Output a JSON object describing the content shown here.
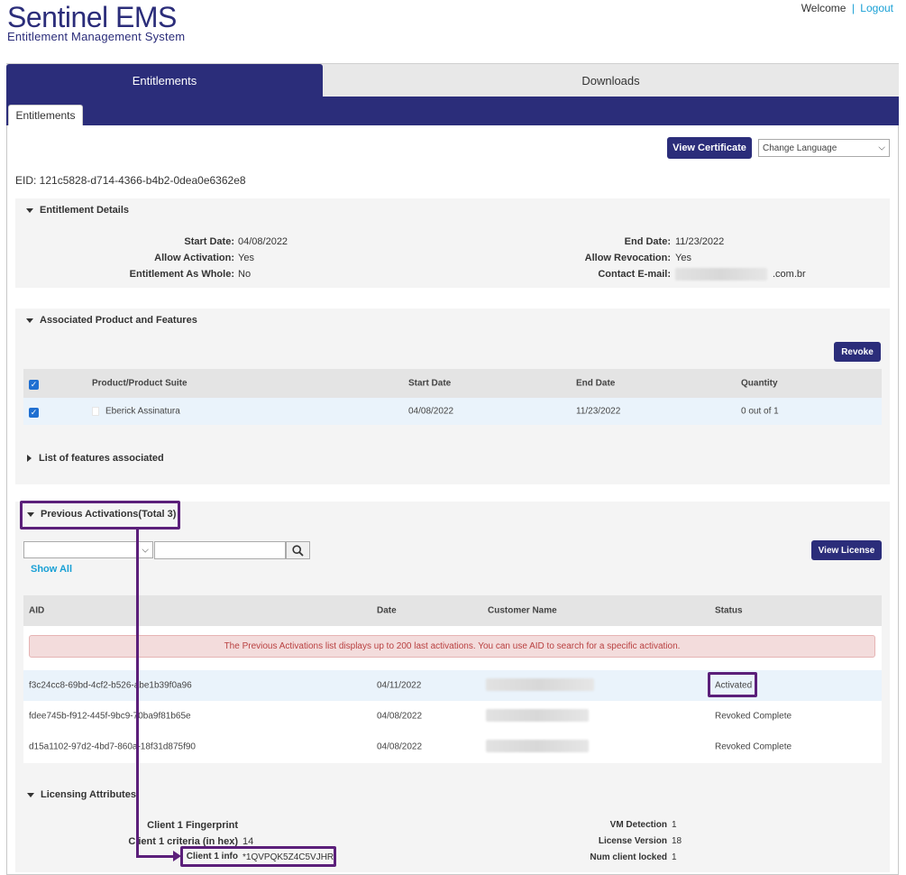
{
  "header": {
    "logo_name": "Sentinel EMS",
    "logo_sub": "Entitlement Management System",
    "welcome": "Welcome",
    "separator": "|",
    "logout": "Logout"
  },
  "tabs": {
    "main": [
      "Entitlements",
      "Downloads"
    ],
    "sub": "Entitlements"
  },
  "toolbar": {
    "view_certificate": "View Certificate",
    "change_language": "Change Language"
  },
  "eid": "EID: 121c5828-d714-4366-b4b2-0dea0e6362e8",
  "entitlement_details": {
    "title": "Entitlement Details",
    "start_date_label": "Start Date:",
    "start_date": "04/08/2022",
    "allow_activation_label": "Allow Activation:",
    "allow_activation": "Yes",
    "as_whole_label": "Entitlement As Whole:",
    "as_whole": "No",
    "end_date_label": "End Date:",
    "end_date": "11/23/2022",
    "allow_revocation_label": "Allow Revocation:",
    "allow_revocation": "Yes",
    "contact_email_label": "Contact E-mail:",
    "contact_email_suffix": ".com.br"
  },
  "products": {
    "title": "Associated Product and Features",
    "revoke": "Revoke",
    "columns": [
      "Product/Product Suite",
      "Start Date",
      "End Date",
      "Quantity"
    ],
    "rows": [
      {
        "product": "Eberick Assinatura",
        "start": "04/08/2022",
        "end": "11/23/2022",
        "quantity": "0 out of 1"
      }
    ],
    "features_link": "List of features associated"
  },
  "activations": {
    "title": "Previous Activations(Total 3)",
    "show_all": "Show All",
    "view_license": "View License",
    "columns": [
      "AID",
      "Date",
      "Customer Name",
      "Status"
    ],
    "notice": "The Previous Activations list displays up to 200 last activations. You can use AID to search for a specific activation.",
    "rows": [
      {
        "aid": "f3c24cc8-69bd-4cf2-b526-abe1b39f0a96",
        "date": "04/11/2022",
        "status": "Activated"
      },
      {
        "aid": "fdee745b-f912-445f-9bc9-70ba9f81b65e",
        "date": "04/08/2022",
        "status": "Revoked Complete"
      },
      {
        "aid": "d15a1102-97d2-4bd7-860a-18f31d875f90",
        "date": "04/08/2022",
        "status": "Revoked Complete"
      }
    ]
  },
  "licensing": {
    "title": "Licensing Attributes",
    "client1_fingerprint_label": "Client 1 Fingerprint",
    "client1_criteria_label": "Client 1 criteria (in hex)",
    "client1_criteria": "14",
    "client1_info_label": "Client 1 info",
    "client1_info": "*1QVPQK5Z4C5VJHR",
    "vm_detection_label": "VM Detection",
    "vm_detection": "1",
    "license_version_label": "License Version",
    "license_version": "18",
    "num_client_locked_label": "Num client locked",
    "num_client_locked": "1"
  },
  "colors": {
    "brand": "#2b2d7a",
    "link": "#19a0d5",
    "highlight": "#5b1f7a",
    "notice_bg": "#f3dcdc"
  }
}
